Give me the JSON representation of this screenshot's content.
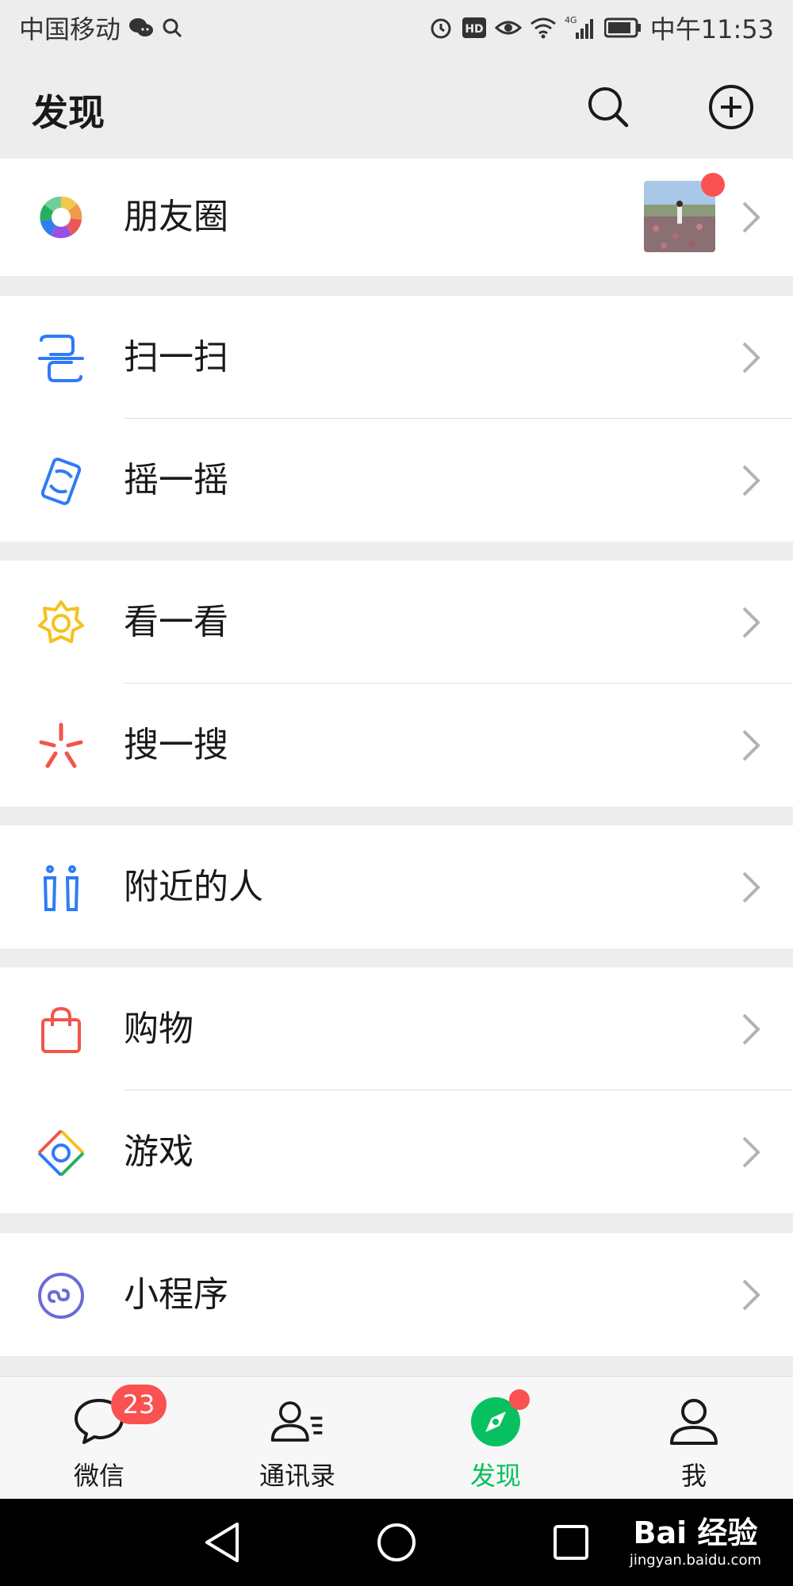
{
  "status": {
    "carrier": "中国移动",
    "network": "4G",
    "time": "中午11:53"
  },
  "header": {
    "title": "发现"
  },
  "groups": [
    {
      "items": [
        {
          "label": "朋友圈",
          "icon": "moments-icon"
        }
      ]
    },
    {
      "items": [
        {
          "label": "扫一扫",
          "icon": "scan-icon"
        },
        {
          "label": "摇一摇",
          "icon": "shake-icon"
        }
      ]
    },
    {
      "items": [
        {
          "label": "看一看",
          "icon": "top-stories-icon"
        },
        {
          "label": "搜一搜",
          "icon": "search-discover-icon"
        }
      ]
    },
    {
      "items": [
        {
          "label": "附近的人",
          "icon": "people-nearby-icon"
        }
      ]
    },
    {
      "items": [
        {
          "label": "购物",
          "icon": "shopping-bag-icon"
        },
        {
          "label": "游戏",
          "icon": "games-icon"
        }
      ]
    },
    {
      "items": [
        {
          "label": "小程序",
          "icon": "mini-programs-icon"
        }
      ]
    }
  ],
  "tabs": [
    {
      "label": "微信",
      "badge": "23",
      "icon": "chat-bubble-icon"
    },
    {
      "label": "通讯录",
      "icon": "contacts-icon"
    },
    {
      "label": "发现",
      "icon": "compass-icon",
      "active": true
    },
    {
      "label": "我",
      "icon": "person-icon"
    }
  ],
  "watermark": {
    "main": "Bai 经验",
    "sub": "jingyan.baidu.com"
  },
  "colors": {
    "accent": "#07c160",
    "badge": "#fa5151",
    "background": "#ededed"
  }
}
